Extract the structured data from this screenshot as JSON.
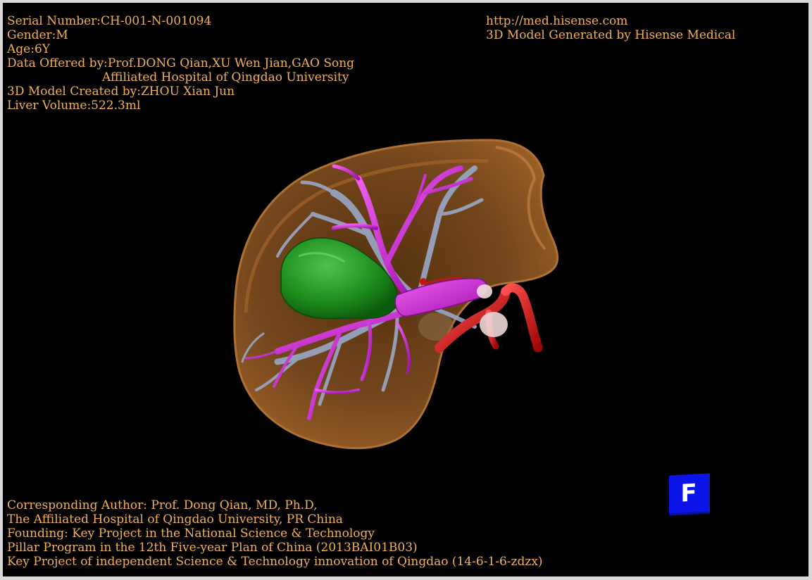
{
  "info_top_left": {
    "serial": "Serial Number:CH-001-N-001094",
    "gender": "Gender:M",
    "age": "Age:6Y",
    "data_offered": "Data Offered by:Prof.DONG Qian,XU Wen Jian,GAO Song",
    "hospital": "Affiliated Hospital of Qingdao University",
    "model_created": "3D Model Created by:ZHOU Xian Jun",
    "liver_volume": "Liver Volume:522.3ml"
  },
  "info_top_right": {
    "url": "http://med.hisense.com",
    "generated": "3D Model Generated by Hisense Medical"
  },
  "info_bottom_left": {
    "author": "Corresponding Author: Prof. Dong Qian, MD, Ph.D,",
    "affiliation": "The Affiliated Hospital of Qingdao University, PR China",
    "founding": "Founding: Key Project in the National Science & Technology",
    "pillar": "Pillar Program in the 12th Five-year Plan of China (2013BAI01B03)",
    "key_project": "Key Project of independent Science & Technology innovation of Qingdao (14-6-1-6-zdzx)"
  },
  "orientation_cube": {
    "label": "F",
    "color": "#0a14e6"
  },
  "colors": {
    "text": "#f0b15a",
    "liver": "#7a4a1e",
    "tumor": "#1f8f1f",
    "portal_vein": "#d030d0",
    "hepatic_vein": "#9aa8c8",
    "artery": "#c81414"
  }
}
